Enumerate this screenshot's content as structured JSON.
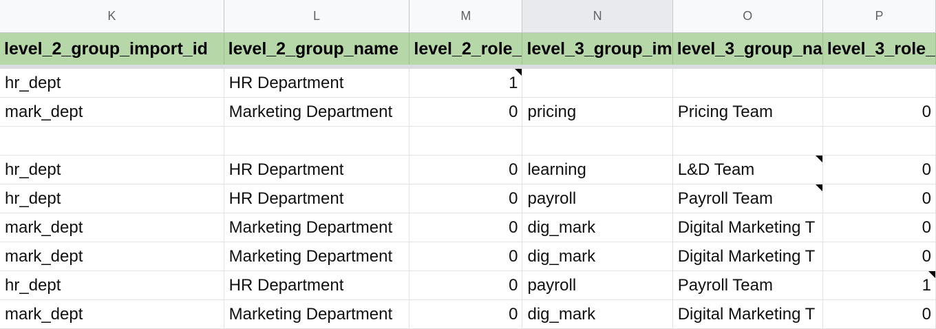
{
  "columns": [
    "K",
    "L",
    "M",
    "N",
    "O",
    "P"
  ],
  "headers": [
    "level_2_group_import_id",
    "level_2_group_name",
    "level_2_role_",
    "level_3_group_im",
    "level_3_group_na",
    "level_3_role_"
  ],
  "rows": [
    [
      "hr_dept",
      "HR Department",
      "1",
      "",
      "",
      ""
    ],
    [
      "mark_dept",
      "Marketing Department",
      "0",
      "pricing",
      "Pricing Team",
      "0"
    ],
    [
      "",
      "",
      "",
      "",
      "",
      ""
    ],
    [
      "hr_dept",
      "HR Department",
      "0",
      "learning",
      "L&D Team",
      "0"
    ],
    [
      "hr_dept",
      "HR Department",
      "0",
      "payroll",
      "Payroll Team",
      "0"
    ],
    [
      "mark_dept",
      "Marketing Department",
      "0",
      "dig_mark",
      "Digital Marketing T",
      "0"
    ],
    [
      "mark_dept",
      "Marketing Department",
      "0",
      "dig_mark",
      "Digital Marketing T",
      "0"
    ],
    [
      "hr_dept",
      "HR Department",
      "0",
      "payroll",
      "Payroll Team",
      "1"
    ],
    [
      "mark_dept",
      "Marketing Department",
      "0",
      "dig_mark",
      "Digital Marketing T",
      "0"
    ]
  ]
}
